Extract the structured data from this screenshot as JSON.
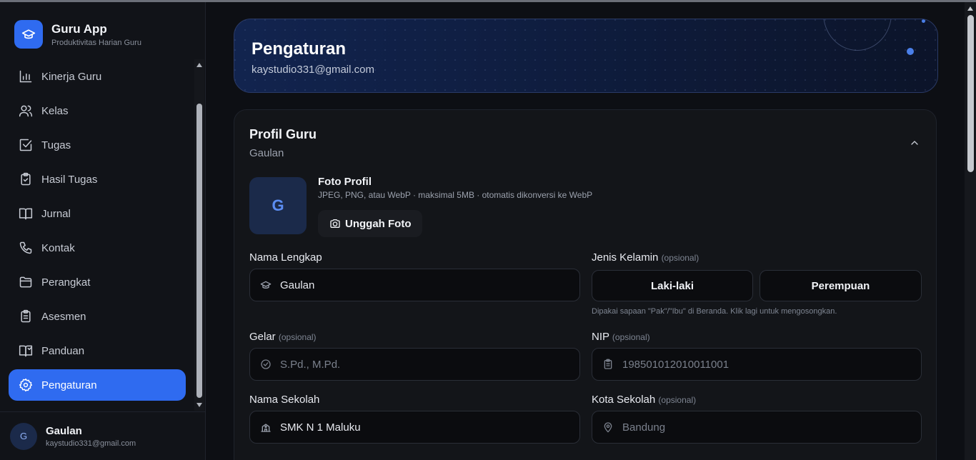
{
  "app": {
    "name": "Guru App",
    "tagline": "Produktivitas Harian Guru"
  },
  "sidebar": {
    "items": [
      {
        "label": "Kinerja Guru",
        "icon": "bar-chart-icon"
      },
      {
        "label": "Kelas",
        "icon": "users-icon"
      },
      {
        "label": "Tugas",
        "icon": "checkbox-icon"
      },
      {
        "label": "Hasil Tugas",
        "icon": "clipboard-check-icon"
      },
      {
        "label": "Jurnal",
        "icon": "book-open-icon"
      },
      {
        "label": "Kontak",
        "icon": "phone-icon"
      },
      {
        "label": "Perangkat",
        "icon": "folder-icon"
      },
      {
        "label": "Asesmen",
        "icon": "clipboard-list-icon"
      },
      {
        "label": "Panduan",
        "icon": "book-guide-icon"
      },
      {
        "label": "Pengaturan",
        "icon": "gear-icon",
        "active": true
      }
    ]
  },
  "user": {
    "initial": "G",
    "name": "Gaulan",
    "email": "kaystudio331@gmail.com"
  },
  "header": {
    "title": "Pengaturan",
    "subtitle": "kaystudio331@gmail.com"
  },
  "profile": {
    "title": "Profil Guru",
    "subtitle": "Gaulan",
    "photo": {
      "initial": "G",
      "title": "Foto Profil",
      "hint": "JPEG, PNG, atau WebP · maksimal 5MB · otomatis dikonversi ke WebP",
      "upload_label": "Unggah Foto"
    },
    "fields": {
      "nama_lengkap": {
        "label": "Nama Lengkap",
        "value": "Gaulan"
      },
      "jenis_kelamin": {
        "label": "Jenis Kelamin",
        "optional": "(opsional)",
        "options": [
          "Laki-laki",
          "Perempuan"
        ],
        "help": "Dipakai sapaan \"Pak\"/\"Ibu\" di Beranda. Klik lagi untuk mengosongkan."
      },
      "gelar": {
        "label": "Gelar",
        "optional": "(opsional)",
        "placeholder": "S.Pd., M.Pd."
      },
      "nip": {
        "label": "NIP",
        "optional": "(opsional)",
        "placeholder": "198501012010011001"
      },
      "nama_sekolah": {
        "label": "Nama Sekolah",
        "value": "SMK N 1 Maluku"
      },
      "kota_sekolah": {
        "label": "Kota Sekolah",
        "optional": "(opsional)",
        "placeholder": "Bandung"
      }
    }
  }
}
